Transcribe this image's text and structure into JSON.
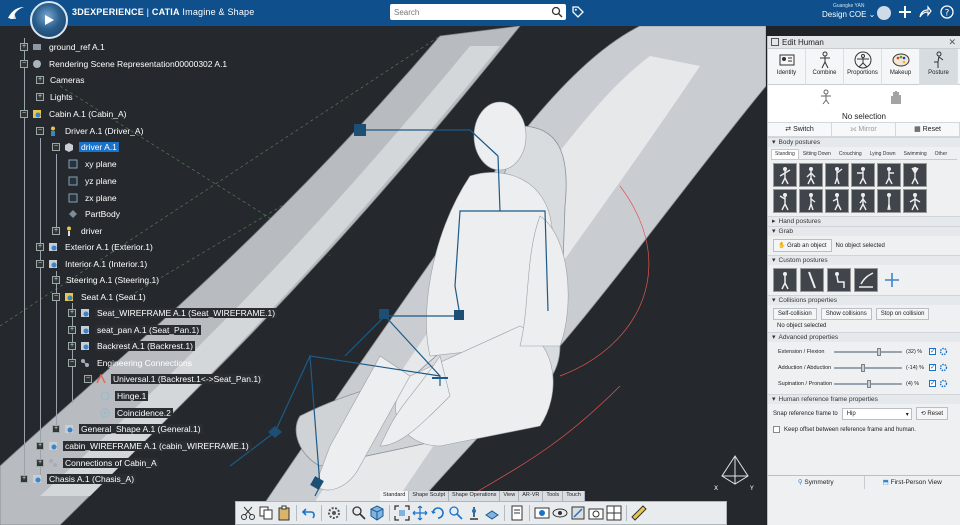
{
  "app": {
    "brand_bold": "3DEXPERIENCE",
    "brand_sep": " | ",
    "brand_app": "CATIA",
    "brand_role": " Imagine & Shape",
    "search_placeholder": "Search",
    "user_name": "Guangke YAN",
    "role": "Design COE ⌄"
  },
  "tree": [
    {
      "label": "ground_ref A.1",
      "indent": 0
    },
    {
      "label": "Rendering Scene Representation00000302 A.1",
      "indent": 0
    },
    {
      "label": "Cameras",
      "indent": 0
    },
    {
      "label": "Lights",
      "indent": 0
    },
    {
      "label": "Cabin A.1 (Cabin_A)",
      "indent": 0
    },
    {
      "label": "Driver A.1 (Driver_A)",
      "indent": 1
    },
    {
      "label": "driver A.1",
      "indent": 2,
      "selected": true
    },
    {
      "label": "xy plane",
      "indent": 3
    },
    {
      "label": "yz plane",
      "indent": 3
    },
    {
      "label": "zx plane",
      "indent": 3
    },
    {
      "label": "PartBody",
      "indent": 3
    },
    {
      "label": "driver",
      "indent": 3
    },
    {
      "label": "Exterior A.1 (Exterior.1)",
      "indent": 1
    },
    {
      "label": "Interior A.1 (Interior.1)",
      "indent": 1
    },
    {
      "label": "Steering A.1 (Steering.1)",
      "indent": 2
    },
    {
      "label": "Seat A.1 (Seat.1)",
      "indent": 2
    },
    {
      "label": "Seat_WIREFRAME A.1 (Seat_WIREFRAME.1)",
      "indent": 3
    },
    {
      "label": "seat_pan A.1 (Seat_Pan.1)",
      "indent": 3
    },
    {
      "label": "Backrest A.1 (Backrest.1)",
      "indent": 3
    },
    {
      "label": "Engineering Connections",
      "indent": 3
    },
    {
      "label": "Universal.1 (Backrest.1<->Seat_Pan.1)",
      "indent": 4
    },
    {
      "label": "Hinge.1",
      "indent": 5
    },
    {
      "label": "Coincidence.2",
      "indent": 5
    },
    {
      "label": "General_Shape A.1 (General.1)",
      "indent": 2
    },
    {
      "label": "cabin_WIREFRAME A.1 (cabin_WIREFRAME.1)",
      "indent": 1
    },
    {
      "label": "Connections of Cabin_A",
      "indent": 1
    },
    {
      "label": "Chasis A.1 (Chasis_A)",
      "indent": 0
    }
  ],
  "panel": {
    "title": "Edit Human",
    "tabs": [
      {
        "label": "Identity",
        "icon": "id-card-icon"
      },
      {
        "label": "Combine",
        "icon": "figure-icon"
      },
      {
        "label": "Proportions",
        "icon": "vitruvian-icon"
      },
      {
        "label": "Makeup",
        "icon": "palette-icon"
      },
      {
        "label": "Posture",
        "icon": "posture-icon"
      }
    ],
    "no_selection": "No selection",
    "actions": [
      "Switch",
      "Mirror",
      "Reset"
    ],
    "body_postures_header": "Body postures",
    "posture_tabs": [
      "Standing",
      "Sitting Down",
      "Crouching",
      "Lying Down",
      "Swimming",
      "Other"
    ],
    "hand_postures_header": "Hand postures",
    "grab_header": "Grab",
    "grab_button": "Grab an object",
    "grab_status": "No object selected",
    "custom_postures_header": "Custom postures",
    "collisions_header": "Collisions properties",
    "collision_buttons": [
      "Self-collision",
      "Show collisions",
      "Stop on collision"
    ],
    "collision_status": "No object selected",
    "advanced_header": "Advanced properties",
    "sliders": [
      {
        "label": "Extension / Flexion",
        "value": "(32) %",
        "level": 0.66
      },
      {
        "label": "Adduction / Abduction",
        "value": "(-14) %",
        "level": 0.43
      },
      {
        "label": "Supination / Pronation",
        "value": "(4) %",
        "level": 0.52
      }
    ],
    "ref_header": "Human reference frame properties",
    "snap_label": "Snap reference frame to",
    "snap_value": "Hip",
    "snap_reset": "Reset",
    "keep_offset": "Keep offset between reference frame and human.",
    "footer": [
      "Symmetry",
      "First-Person View"
    ]
  },
  "toolbar_tabs": [
    "Standard",
    "Shape Sculpt",
    "Shape Operations",
    "View",
    "AR-VR",
    "Tools",
    "Touch"
  ],
  "colors": {
    "topbar": "#0e4f8c",
    "selection": "#1a73c9",
    "panel_bg": "#eef0f2"
  }
}
